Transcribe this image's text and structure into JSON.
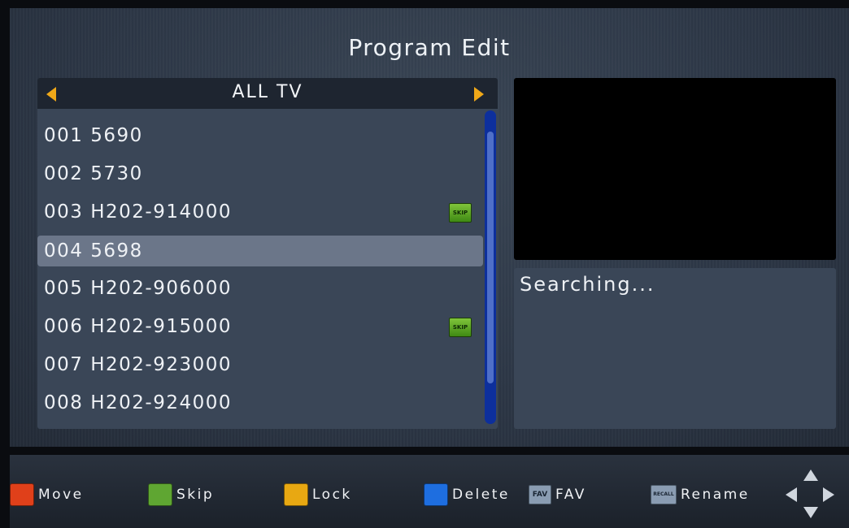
{
  "title": "Program Edit",
  "group": {
    "label": "ALL TV",
    "prev_icon": "triangle-left-icon",
    "next_icon": "triangle-right-icon"
  },
  "channels": [
    {
      "label": "001 5690",
      "skip": false
    },
    {
      "label": "002 5730",
      "skip": false
    },
    {
      "label": "003 H202-914000",
      "skip": true
    },
    {
      "label": "004 5698",
      "skip": false,
      "selected": true
    },
    {
      "label": "005 H202-906000",
      "skip": false
    },
    {
      "label": "006 H202-915000",
      "skip": true
    },
    {
      "label": "007 H202-923000",
      "skip": false
    },
    {
      "label": "008 H202-924000",
      "skip": false
    }
  ],
  "skip_badge_text": "SKIP",
  "info": {
    "status": "Searching..."
  },
  "footer": {
    "move": {
      "label": "Move",
      "color": "#e0401a"
    },
    "skip": {
      "label": "Skip",
      "color": "#5fa632"
    },
    "lock": {
      "label": "Lock",
      "color": "#e8a812"
    },
    "delete": {
      "label": "Delete",
      "color": "#1e6ee0"
    },
    "fav": {
      "icon_text": "FAV",
      "label": "FAV"
    },
    "rename": {
      "icon_text": "RECALL",
      "label": "Rename"
    },
    "nav_icon": "dpad-arrows-icon"
  },
  "colors": {
    "accent_arrow": "#f0a818",
    "scrollbar": "#0d2f9c",
    "selected_row": "#6b7689"
  }
}
